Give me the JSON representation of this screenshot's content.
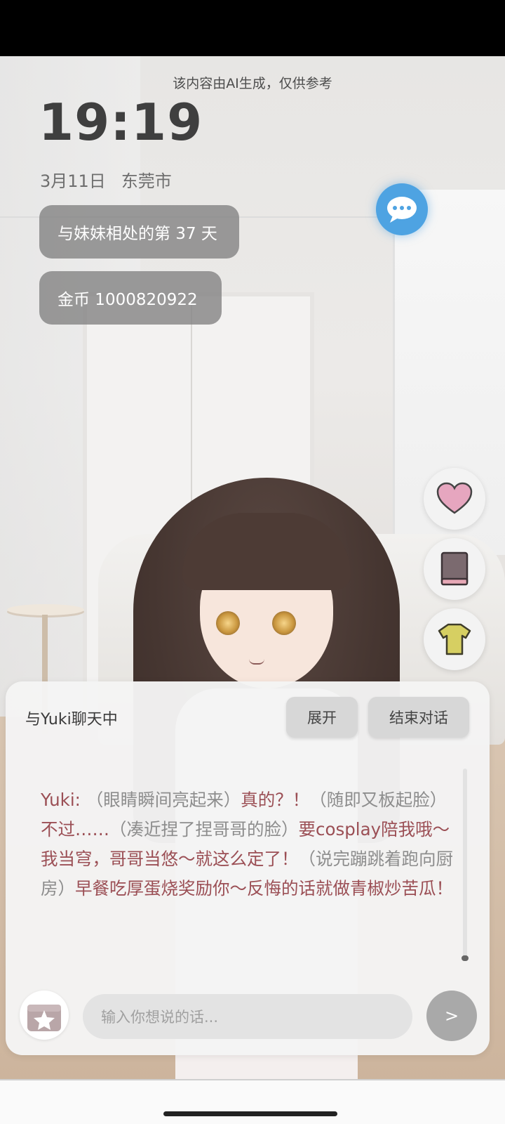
{
  "header": {
    "ai_note": "该内容由AI生成，仅供参考",
    "time": "19:19",
    "date": "3月11日",
    "city": "东莞市"
  },
  "stats": {
    "days_label": "与妹妹相处的第 37 天",
    "coins_label": "金币 1000820922"
  },
  "side_buttons": [
    "heart-icon",
    "book-icon",
    "shirt-icon"
  ],
  "chat": {
    "title": "与Yuki聊天中",
    "expand_label": "展开",
    "end_label": "结束对话",
    "message": {
      "speaker": "Yuki:",
      "segments": [
        {
          "type": "act",
          "text": "（眼睛瞬间亮起来）"
        },
        {
          "type": "speech",
          "text": "真的？！"
        },
        {
          "type": "act",
          "text": "（随即又板起脸）"
        },
        {
          "type": "speech",
          "text": "不过……"
        },
        {
          "type": "act",
          "text": "（凑近捏了捏哥哥的脸）"
        },
        {
          "type": "speech",
          "text": "要cosplay陪我哦～我当穹，哥哥当悠～就这么定了！"
        },
        {
          "type": "act",
          "text": "（说完蹦跳着跑向厨房）"
        },
        {
          "type": "speech",
          "text": "早餐吃厚蛋烧奖励你～反悔的话就做青椒炒苦瓜！"
        }
      ]
    },
    "input_placeholder": "输入你想说的话...",
    "send_label": ">"
  },
  "colors": {
    "speech": "#9b4f55",
    "action": "#8d8d8d",
    "chat_button": "#4ea3e2"
  }
}
